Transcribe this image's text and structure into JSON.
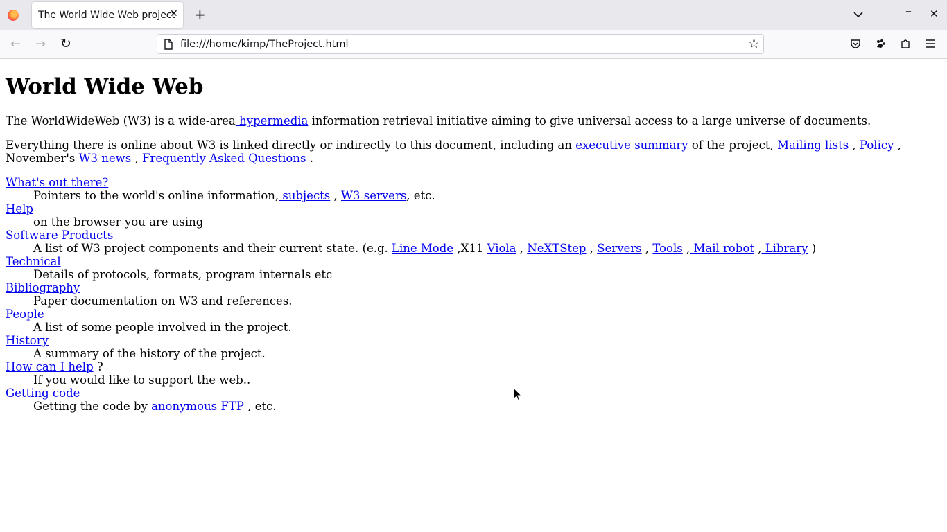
{
  "browser": {
    "tab_title": "The World Wide Web project",
    "tab_close": "✕",
    "new_tab": "+",
    "url": "file:///home/kimp/TheProject.html",
    "back": "←",
    "forward": "→",
    "reload": "↻",
    "bookmark": "☆",
    "window_min": "–",
    "window_close": "✕"
  },
  "page": {
    "title": "World Wide Web",
    "intro": {
      "before": "The WorldWideWeb (W3) is a wide-area",
      "link": " hypermedia",
      "after": " information retrieval initiative aiming to give universal access to a large universe of documents."
    },
    "p2": {
      "t1": "Everything there is online about W3 is linked directly or indirectly to this document, including an ",
      "l1": "executive summary",
      "t2": " of the project, ",
      "l2": "Mailing lists",
      "t3": " , ",
      "l3": "Policy",
      "t4": " , November's ",
      "l4": "W3 news",
      "t5": " , ",
      "l5": "Frequently Asked Questions",
      "t6": " ."
    },
    "items": [
      {
        "term": "What's out there?",
        "d1": "Pointers to the world's online information,",
        "l1": " subjects",
        "d2": " , ",
        "l2": "W3 servers",
        "d3": ", etc."
      },
      {
        "term": "Help",
        "desc": "on the browser you are using"
      },
      {
        "term": "Software Products",
        "d1": "A list of W3 project components and their current state. (e.g. ",
        "l1": "Line Mode",
        "d2": " ,X11 ",
        "l2": "Viola",
        "d3": " , ",
        "l3": "NeXTStep",
        "d4": " , ",
        "l4": "Servers",
        "d5": " , ",
        "l5": "Tools",
        "d6": " ,",
        "l6": " Mail robot",
        "d7": " ,",
        "l7": " Library",
        "d8": " )"
      },
      {
        "term": "Technical",
        "desc": "Details of protocols, formats, program internals etc"
      },
      {
        "term": "Bibliography",
        "desc": "Paper documentation on W3 and references."
      },
      {
        "term": "People",
        "desc": "A list of some people involved in the project."
      },
      {
        "term": "History",
        "desc": "A summary of the history of the project."
      },
      {
        "term": "How can I help",
        "term_after": " ?",
        "desc": "If you would like to support the web.."
      },
      {
        "term": "Getting code",
        "d1": "Getting the code by",
        "l1": " anonymous FTP",
        "d2": " , etc."
      }
    ]
  }
}
